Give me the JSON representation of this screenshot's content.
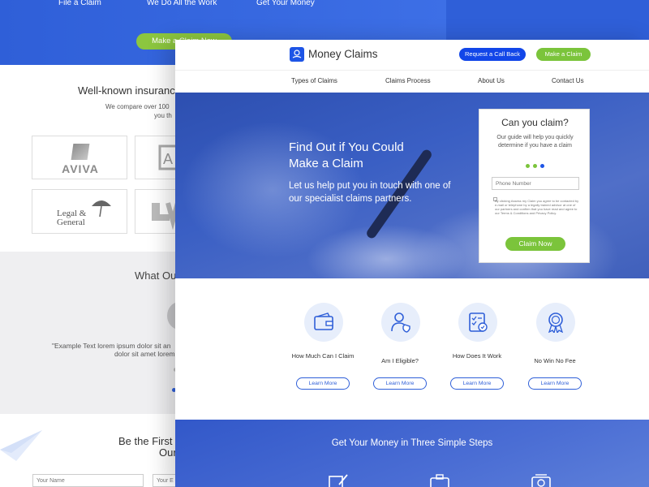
{
  "back_page": {
    "hero_links": [
      "File a Claim",
      "We Do All the Work",
      "Get Your Money"
    ],
    "hero_button": "Make a Claim Now",
    "insurers": {
      "title": "Well-known insuranc",
      "subtitle_line1": "We compare over 100",
      "subtitle_line2": "you th",
      "logos": [
        "AVIVA",
        "Legal &",
        "General"
      ]
    },
    "testimonials": {
      "title": "What Ou",
      "quote_line1": "\"Example Text lorem ipsum dolor sit an",
      "quote_line2": "dolor sit amet lorem"
    },
    "signup": {
      "title_line1": "Be the First",
      "title_line2": "Our",
      "placeholder_name": "Your Name",
      "placeholder_email": "Your E"
    }
  },
  "front_page": {
    "logo_text": "Money Claims",
    "header": {
      "callback_label": "Request a Call Back",
      "claim_label": "Make a Claim"
    },
    "nav": [
      "Types of Claims",
      "Claims Process",
      "About Us",
      "Contact Us"
    ],
    "hero": {
      "title_line1": "Find Out if You Could",
      "title_line2": "Make a Claim",
      "text": "Let us help put you in touch with one of our specialist claims partners."
    },
    "claim_box": {
      "title": "Can you claim?",
      "desc": "Our guide will help you quickly determine if you have a claim",
      "phone_placeholder": "Phone Number",
      "consent": "By clicking Assess my Claim you agree to be contacted by e-mail or telephone by a legally trained advisor at one of our partners and confirm that you have read and agree to our Terms & Conditions and Privacy Policy.",
      "button": "Claim Now"
    },
    "features": [
      {
        "label": "How Much Can I Claim",
        "button": "Learn More",
        "icon": "wallet-icon"
      },
      {
        "label": "Am I Eligible?",
        "button": "Learn More",
        "icon": "user-shield-icon"
      },
      {
        "label": "How Does It Work",
        "button": "Learn More",
        "icon": "checklist-icon"
      },
      {
        "label": "No Win No Fee",
        "button": "Learn More",
        "icon": "award-ribbon-icon"
      }
    ],
    "steps": {
      "title": "Get Your Money in Three Simple Steps",
      "icons": [
        "document-pen-icon",
        "briefcase-icon",
        "money-icon"
      ]
    }
  },
  "colors": {
    "brand_blue": "#1e55e6",
    "accent_green": "#7bc43b",
    "hero_blue": "#2f5fd8"
  }
}
